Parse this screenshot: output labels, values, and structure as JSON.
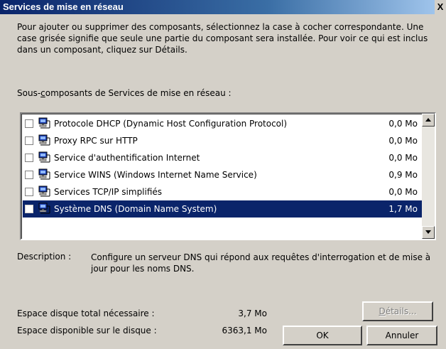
{
  "window": {
    "title": "Services de mise en réseau",
    "close_glyph": "X"
  },
  "intro_text": "Pour ajouter ou supprimer des composants, sélectionnez la case à cocher correspondante. Une case grisée signifie que seule une partie du composant sera installée. Pour voir ce qui est inclus dans un composant, cliquez sur Détails.",
  "sub_components_label": {
    "before": "Sous-",
    "accel": "c",
    "after": "omposants de Services de mise en réseau :"
  },
  "components": [
    {
      "label": "Protocole DHCP (Dynamic Host Configuration Protocol)",
      "size": "0,0 Mo",
      "checked": false,
      "selected": false
    },
    {
      "label": "Proxy RPC sur HTTP",
      "size": "0,0 Mo",
      "checked": false,
      "selected": false
    },
    {
      "label": "Service d'authentification Internet",
      "size": "0,0 Mo",
      "checked": false,
      "selected": false
    },
    {
      "label": "Service WINS (Windows Internet Name Service)",
      "size": "0,9 Mo",
      "checked": false,
      "selected": false
    },
    {
      "label": "Services TCP/IP simplifiés",
      "size": "0,0 Mo",
      "checked": false,
      "selected": false
    },
    {
      "label": "Système DNS (Domain Name System)",
      "size": "1,7 Mo",
      "checked": false,
      "selected": true
    }
  ],
  "description": {
    "label": "Description :",
    "text": "Configure un serveur DNS qui répond aux requêtes d'interrogation et de mise à jour pour les noms DNS."
  },
  "disk": {
    "required_label": "Espace disque total nécessaire :",
    "required_value": "3,7 Mo",
    "available_label": "Espace disponible sur le disque :",
    "available_value": "6363,1 Mo"
  },
  "buttons": {
    "details_accel": "D",
    "details_rest": "étails...",
    "ok": "OK",
    "cancel": "Annuler"
  },
  "colors": {
    "selection": "#0a246a",
    "dialog_face": "#d4d0c8"
  }
}
